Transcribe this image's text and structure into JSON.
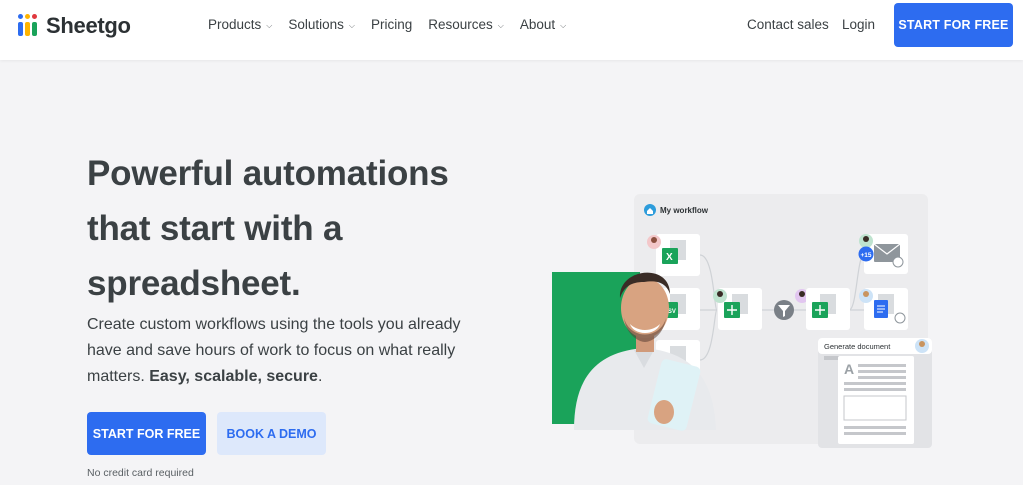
{
  "brand": {
    "name": "Sheetgo"
  },
  "nav": {
    "items": [
      {
        "label": "Products",
        "dropdown": true
      },
      {
        "label": "Solutions",
        "dropdown": true
      },
      {
        "label": "Pricing",
        "dropdown": false
      },
      {
        "label": "Resources",
        "dropdown": true
      },
      {
        "label": "About",
        "dropdown": true
      }
    ],
    "contact_label": "Contact sales",
    "login_label": "Login",
    "cta_label": "START FOR FREE"
  },
  "hero": {
    "headline": "Powerful automations that start with a spreadsheet.",
    "subtitle_plain": "Create custom workflows using the tools you already have and save hours of work to focus on what really matters. ",
    "subtitle_bold": "Easy, scalable, secure",
    "subtitle_end": ".",
    "primary_button": "START FOR FREE",
    "secondary_button": "BOOK A DEMO",
    "note": "No credit card required"
  },
  "illustration": {
    "workflow_title": "My workflow",
    "badge_count": "+15",
    "csv_label": "CSV",
    "excel_label": "X",
    "generate_label": "Generate document",
    "doc_letter": "A"
  },
  "colors": {
    "accent": "#2d6cf0",
    "accent_light": "#dde8fb",
    "green": "#1aa35a",
    "text": "#3b4144",
    "bg": "#f4f4f6"
  }
}
